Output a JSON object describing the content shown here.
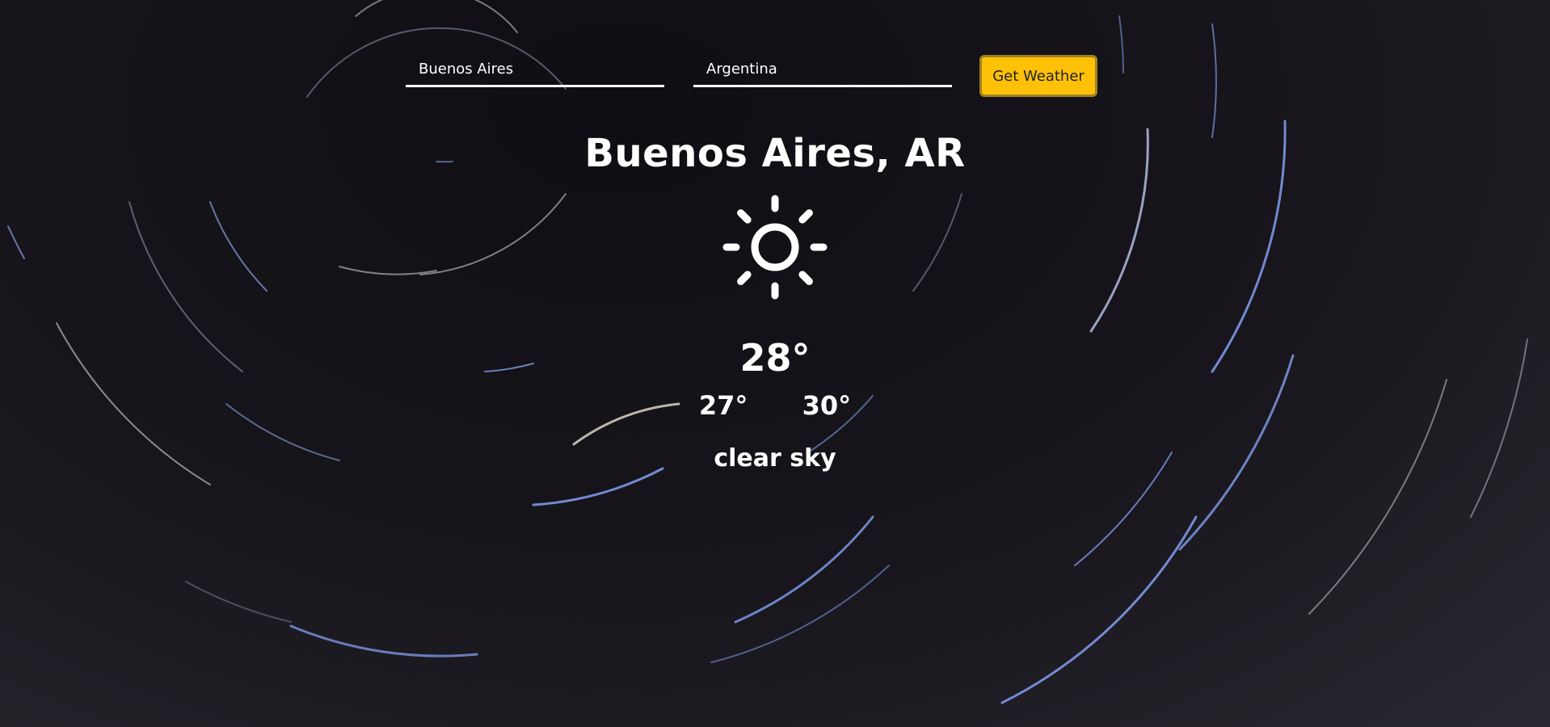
{
  "search": {
    "city_value": "Buenos Aires",
    "country_value": "Argentina",
    "submit_label": "Get Weather"
  },
  "weather": {
    "location": "Buenos Aires, AR",
    "icon": "sun-icon",
    "temperature": "28°",
    "temp_min": "27°",
    "temp_max": "30°",
    "description": "clear sky"
  },
  "colors": {
    "accent": "#ffc107",
    "background": "#18161c",
    "text": "#ffffff"
  }
}
